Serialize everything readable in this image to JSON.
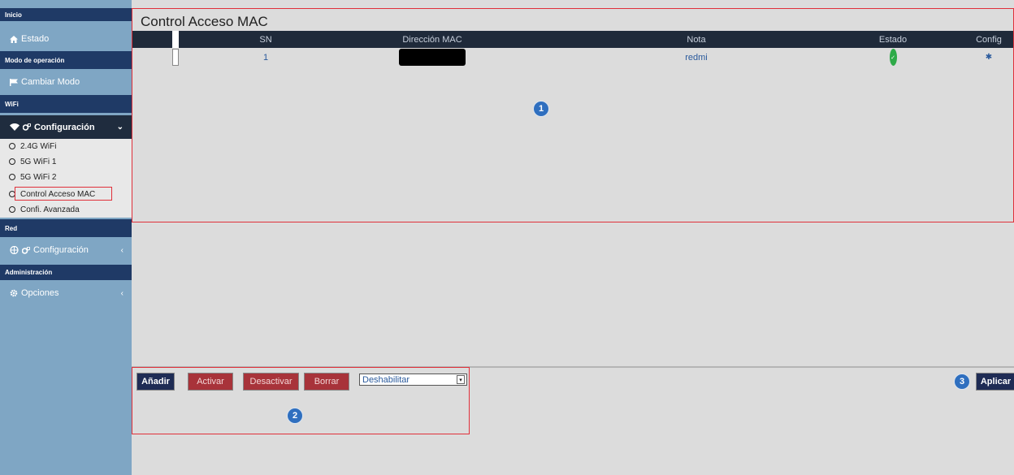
{
  "sidebar": {
    "sections": {
      "inicio": "Inicio",
      "modo": "Modo de operación",
      "wifi": "WiFi",
      "red": "Red",
      "admin": "Administración"
    },
    "items": {
      "estado": "Estado",
      "cambiar_modo": "Cambiar Modo",
      "wifi_config": "Configuración",
      "red_config": "Configuración",
      "opciones": "Opciones"
    },
    "wifi_sub": [
      "2.4G WiFi",
      "5G WiFi 1",
      "5G WiFi 2",
      "Control Acceso MAC",
      "Confi. Avanzada"
    ],
    "icons": {
      "estado": "home-icon",
      "cambiar_modo": "flag-icon",
      "wifi_config": "wifi-icon",
      "red_config": "network-icon",
      "opciones": "gear-icon"
    },
    "chevron_open": "⌄",
    "chevron_closed": "‹"
  },
  "main": {
    "title": "Control Acceso MAC",
    "table": {
      "headers": [
        "SN",
        "Dirección MAC",
        "Nota",
        "Estado",
        "Config"
      ],
      "rows": [
        {
          "sn": "1",
          "mac": "",
          "nota": "redmi",
          "estado": "enabled",
          "config": "gear-icon"
        }
      ]
    },
    "buttons": {
      "anadir": "Añadir",
      "activar": "Activar",
      "desactivar": "Desactivar",
      "borrar": "Borrar",
      "aplicar": "Aplicar"
    },
    "select_value": "Deshabilitar",
    "badges": [
      "1",
      "2",
      "3"
    ]
  },
  "colors": {
    "sidebar_bg": "#7fa6c4",
    "section_header": "#1f3a66",
    "table_header": "#1f2a3a",
    "highlight_red": "#e0303a",
    "badge_blue": "#2f6fbf",
    "btn_dark": "#1f2c55",
    "btn_red": "#a8333a"
  }
}
